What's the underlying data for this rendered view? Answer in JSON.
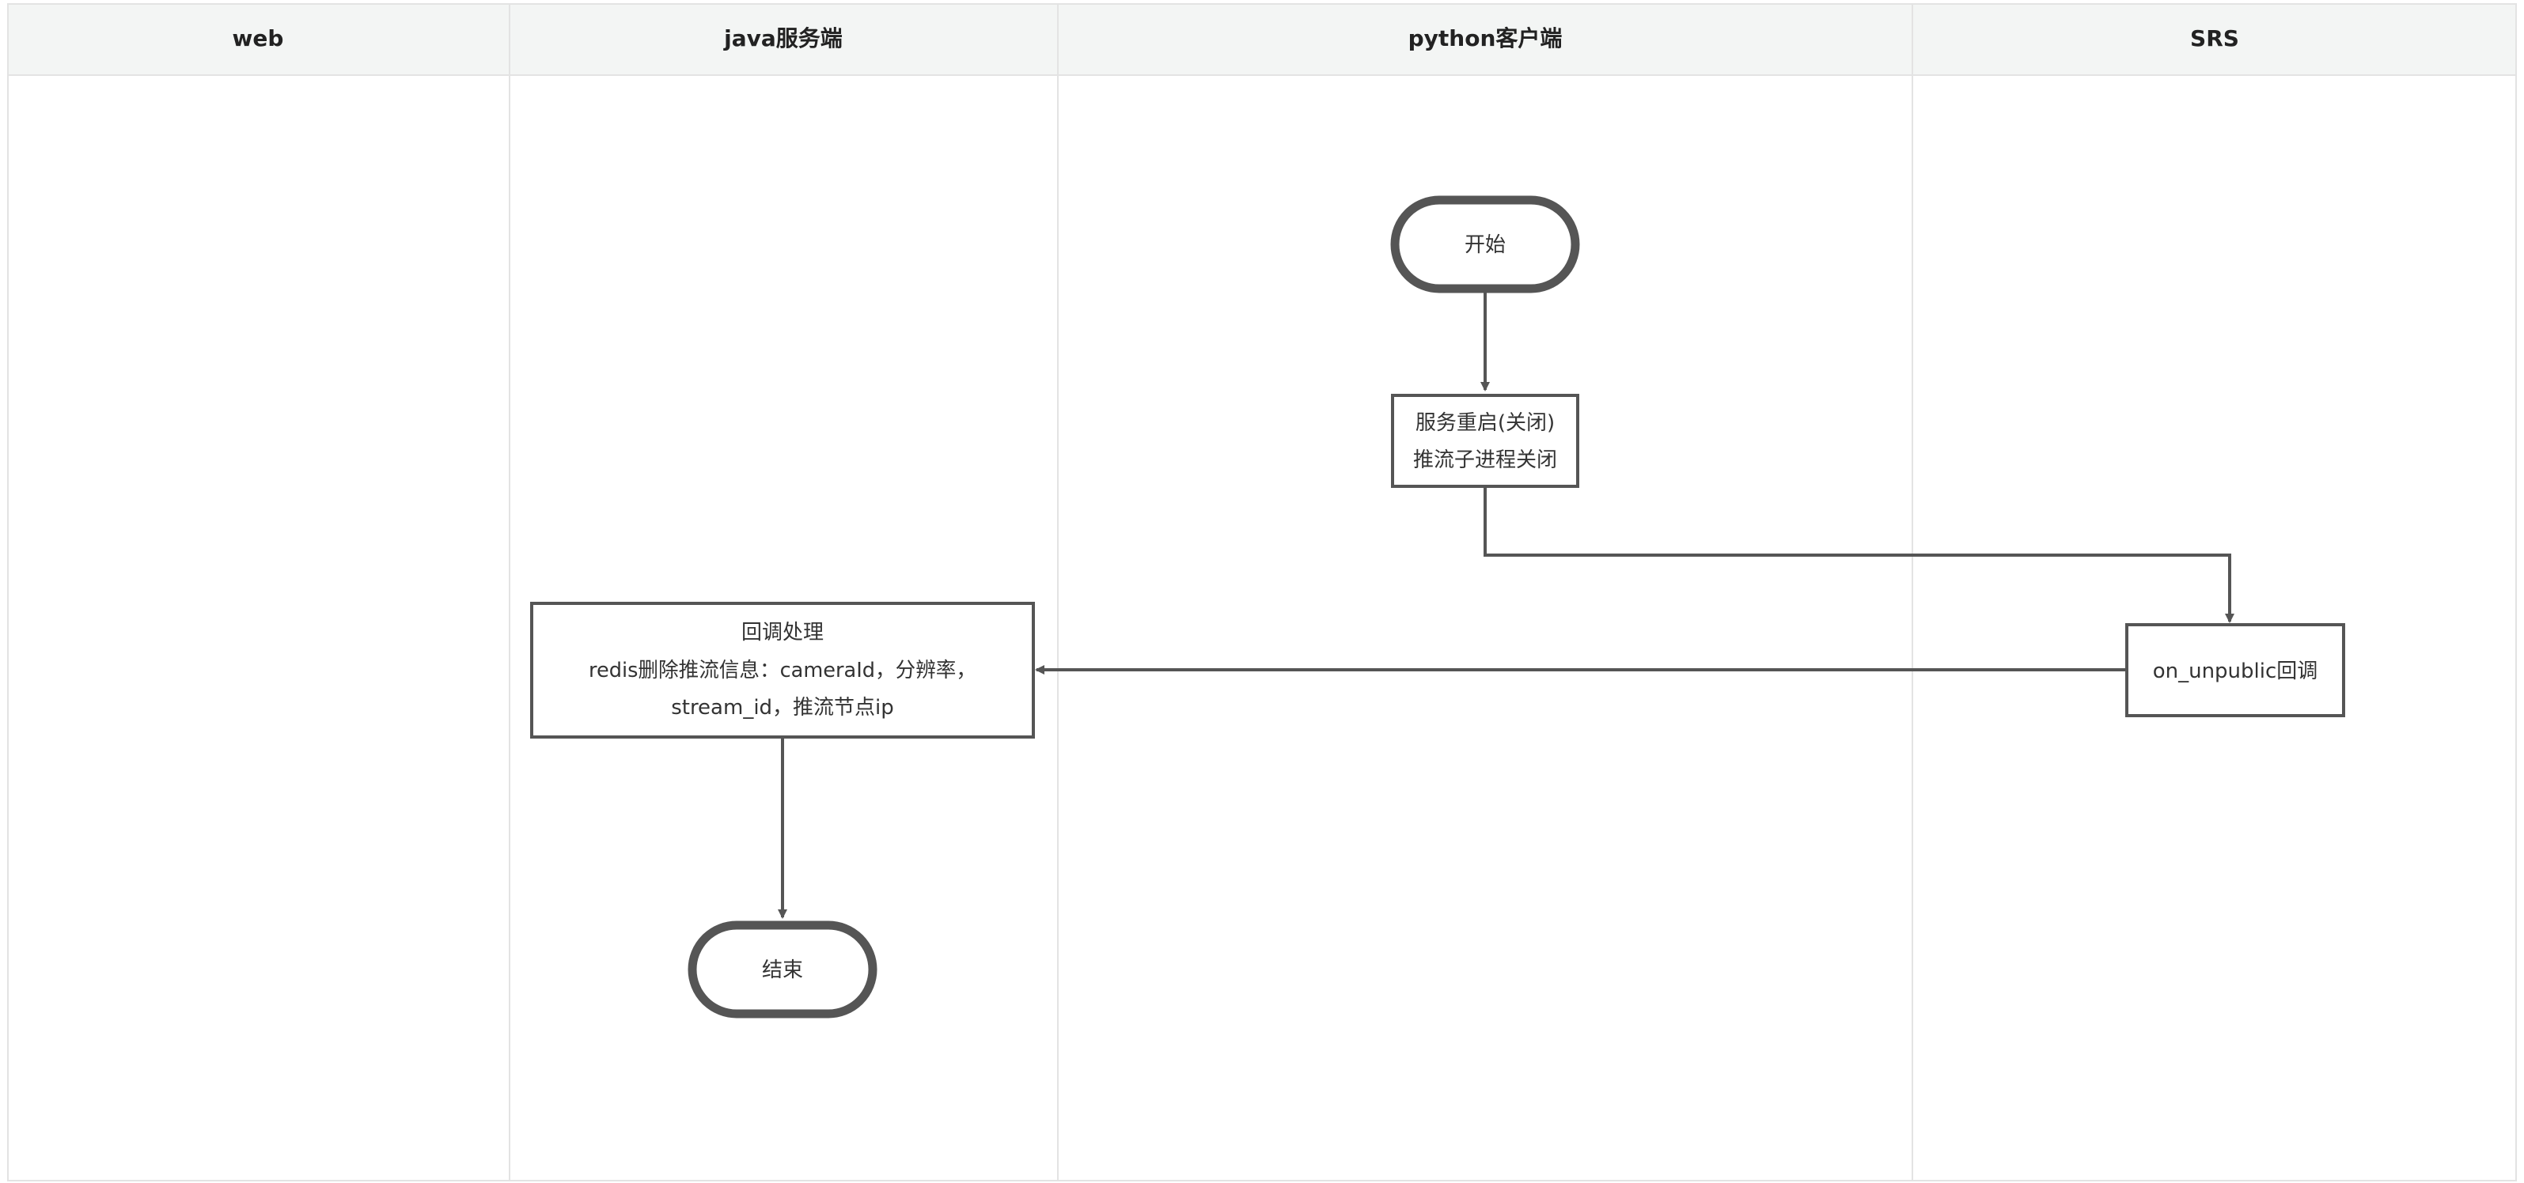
{
  "lanes": [
    {
      "title": "web"
    },
    {
      "title": "java服务端"
    },
    {
      "title": "python客户端"
    },
    {
      "title": "SRS"
    }
  ],
  "nodes": {
    "start": {
      "label": "开始"
    },
    "restart": {
      "lines": [
        "服务重启(关闭)",
        "推流子进程关闭"
      ]
    },
    "callback": {
      "label": "on_unpublic回调"
    },
    "process": {
      "lines": [
        "回调处理",
        "redis删除推流信息：cameraId，分辨率，",
        "stream_id，推流节点ip"
      ]
    },
    "end": {
      "label": "结束"
    }
  },
  "colors": {
    "header_bg": "#f3f5f4",
    "grid_line": "#e3e3e3",
    "node_stroke": "#555555",
    "edge": "#555555"
  }
}
